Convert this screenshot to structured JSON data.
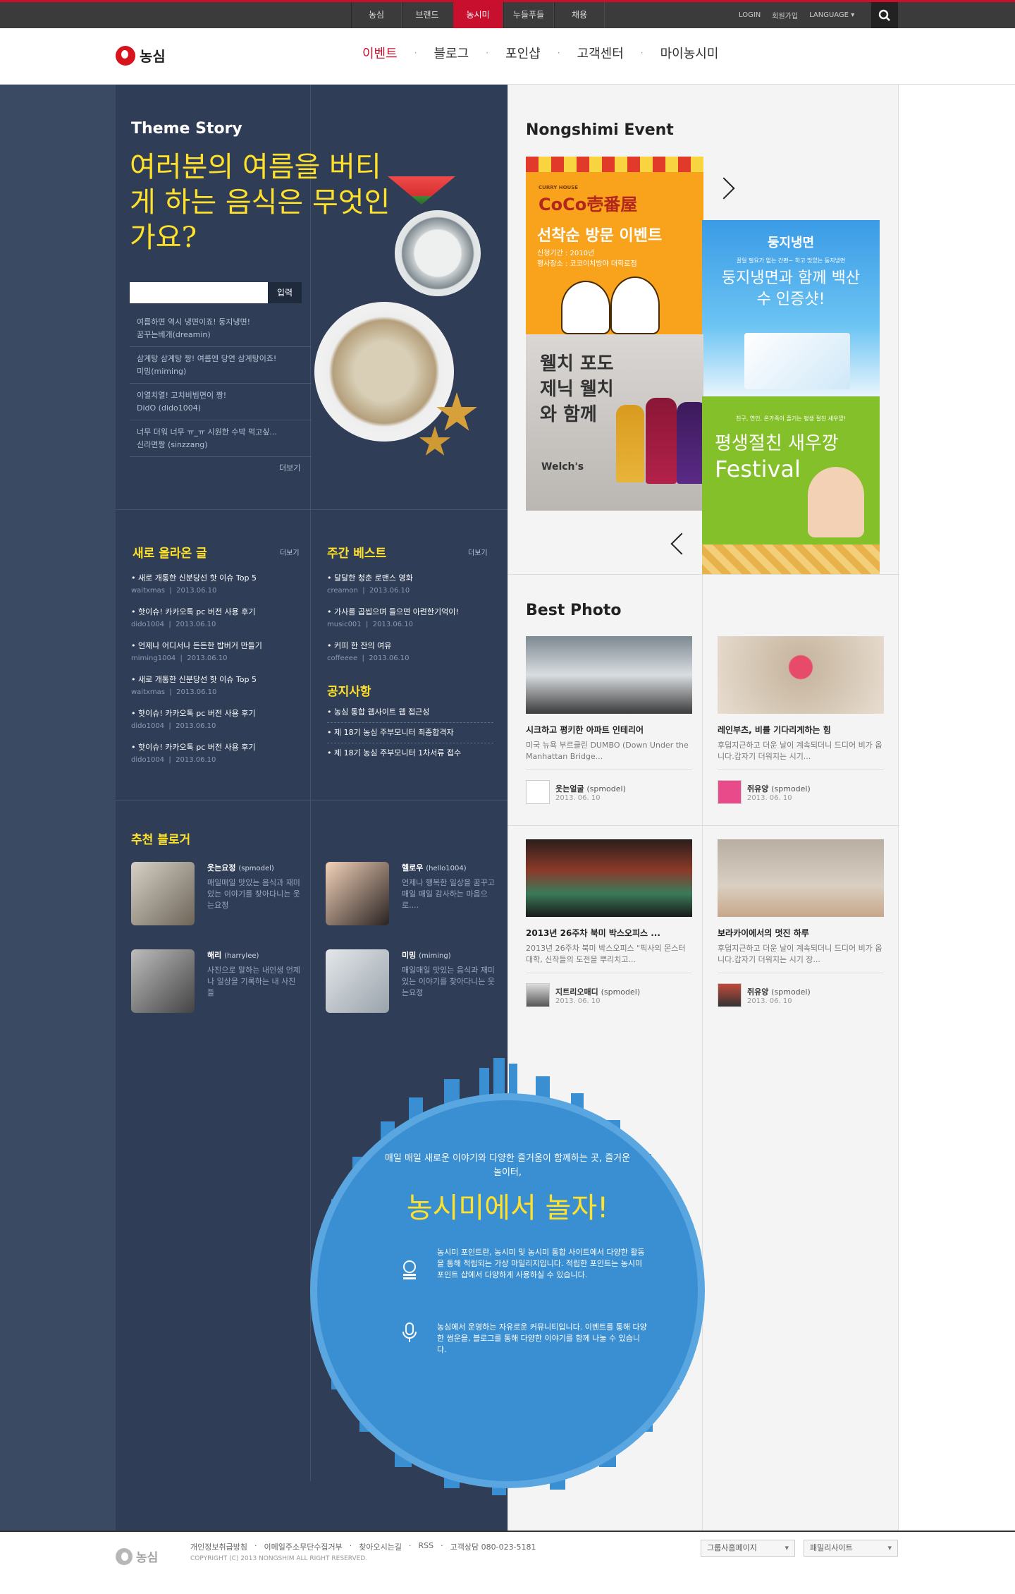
{
  "topnav": {
    "items": [
      "농심",
      "브랜드",
      "농시미",
      "누들푸들",
      "채용"
    ],
    "active_index": 2,
    "login": "LOGIN",
    "join": "회원가입",
    "language": "LANGUAGE"
  },
  "header": {
    "logo": "농심",
    "gnb": [
      "이벤트",
      "블로그",
      "포인샵",
      "고객센터",
      "마이농시미"
    ]
  },
  "theme": {
    "title": "Theme Story",
    "headline": "여러분의 여름을 버티게 하는 음식은 무엇인가요?",
    "input_placeholder": "",
    "submit_label": "입력",
    "comments": [
      {
        "text": "여름하면 역시 냉면이죠! 둥지냉면!",
        "author": "꿈꾸는베개(dreamin)"
      },
      {
        "text": "삼계탕 삼계탕 짱! 여름엔 당연 삼계탕이죠!",
        "author": "미밍(miming)"
      },
      {
        "text": "이열치열! 고치비빔면이 짱!",
        "author": "DidO (dido1004)"
      },
      {
        "text": "너무 더워 너무 ㅠ_ㅠ 시원한 수박 먹고싶...",
        "author": "신라면짱 (sinzzang)"
      }
    ],
    "more": "더보기"
  },
  "new_posts": {
    "title": "새로 올라온 글",
    "more": "더보기",
    "items": [
      {
        "title": "새로 개통한 신분당선 핫 이슈 Top 5",
        "author": "waitxmas",
        "date": "2013.06.10"
      },
      {
        "title": "핫이슈! 카카오톡 pc 버전 사용 후기",
        "author": "dido1004",
        "date": "2013.06.10"
      },
      {
        "title": "언제나 어디서나 든든한 밥버거 만들기",
        "author": "miming1004",
        "date": "2013.06.10"
      },
      {
        "title": "새로 개통한 신분당선 핫 이슈 Top 5",
        "author": "waitxmas",
        "date": "2013.06.10"
      },
      {
        "title": "핫이슈! 카카오톡 pc 버전 사용 후기",
        "author": "dido1004",
        "date": "2013.06.10"
      },
      {
        "title": "핫이슈! 카카오톡 pc 버전 사용 후기",
        "author": "dido1004",
        "date": "2013.06.10"
      }
    ]
  },
  "weekly_best": {
    "title": "주간 베스트",
    "more": "더보기",
    "items": [
      {
        "title": "달달한 청춘 로맨스 영화",
        "author": "creamon",
        "date": "2013.06.10"
      },
      {
        "title": "가사를 곱씹으며 들으면 아련한기억이!",
        "author": "music001",
        "date": "2013.06.10"
      },
      {
        "title": "커피 한 잔의 여유",
        "author": "coffeeee",
        "date": "2013.06.10"
      }
    ]
  },
  "notice": {
    "title": "공지사항",
    "items": [
      "농심 통합 웹사이트 웹 접근성",
      "제 18기 농심 주부모니터 최종합격자",
      "제 18기 농심 주부모니터 1차서류 접수"
    ]
  },
  "bloggers": {
    "title": "추천 블로거",
    "items": [
      {
        "name": "웃는요정",
        "id": "(spmodel)",
        "desc": "매일매일 맛있는 음식과 재미있는 이야기를 찾아다니는 웃는요정"
      },
      {
        "name": "헬로우",
        "id": "(hello1004)",
        "desc": "언제나 행복한 일상을 꿈꾸고 매일 매일 감사하는 마음으로...."
      },
      {
        "name": "해리",
        "id": "(harrylee)",
        "desc": "사진으로 말하는 내인생 언제나 일상을 기록하는 내 사진들"
      },
      {
        "name": "미밍",
        "id": "(miming)",
        "desc": "매일매일 맛있는 음식과 재미있는 이야기를 찾아다니는 웃는요정"
      }
    ]
  },
  "promo": {
    "intro": "매일 매일 새로운 이야기와 다양한 즐거움이 함께하는 곳, 즐거운 놀이터,",
    "headline": "농시미에서 놀자!",
    "point": "농시미 포인트란, 농시미 및 농시미 통합 사이트에서 다양한 활동을 통해 적립되는 가상 마일리지입니다. 적립한 포인트는 농시미포인트 샵에서 다양하게 사용하실 수 있습니다.",
    "community": "농심에서 운영하는 자유로운 커뮤니티입니다. 이벤트를 통해 다양한 썸운을, 블로그를 통해 다양한 이야기를 함께 나눌 수 있습니다.",
    "icon1": "rss-icon",
    "icon2": "microphone-icon"
  },
  "events": {
    "title": "Nongshimi Event",
    "coco": {
      "brand_small": "CURRY HOUSE",
      "brand": "CoCo壱番屋",
      "headline": "선착순 방문 이벤트",
      "period": "신청기간 : 2010년",
      "place": "행사장소 : 코코이치방야 대학로점"
    },
    "dungji": {
      "brand": "둥지냉면",
      "sub": "꼴일 필요가 없는 간편~ 하고 맛있는 둥지냉면",
      "headline": "둥지냉면과 함께 백산수 인증샷!"
    },
    "welchs": {
      "headline": "웰치 포도제닉 웰치와 함께",
      "brand": "Welch's"
    },
    "saewoo": {
      "sub": "친구, 연인, 온가족이 즐기는 평생 절친 새우깡!",
      "headline1": "평생절친 새우깡",
      "headline2": "Festival"
    }
  },
  "best_photo": {
    "title": "Best Photo",
    "items": [
      {
        "title": "시크하고 평키한 아파트 인테리어",
        "desc": "미국 뉴욕 부르클린 DUMBO (Down Under the Manhattan Bridge...",
        "author": "웃는얼굴",
        "id": "(spmodel)",
        "date": "2013. 06. 10"
      },
      {
        "title": "레인부츠, 비를 기다리게하는 힘",
        "desc": "후덥지근하고 더운 날이 계속되더니 드디어 비가 옵니다.갑자기 더워지는 시기...",
        "author": "쥐유앙",
        "id": "(spmodel)",
        "date": "2013. 06. 10"
      },
      {
        "title": "2013년 26주차 북미 박스오피스 ...",
        "desc": "2013년 26주차 북미 박스오피스 \"픽사의 몬스터대학, 신작들의 도전을 뿌리치고...",
        "author": "지트리오매디",
        "id": "(spmodel)",
        "date": "2013. 06. 10"
      },
      {
        "title": "보라카이에서의 멋진 하루",
        "desc": "후덥지근하고 더운 날이 계속되더니 드디어 비가 옵니다.갑자기 더워지는 시기 장...",
        "author": "쥐유앙",
        "id": "(spmodel)",
        "date": "2013. 06. 10"
      }
    ]
  },
  "footer": {
    "logo": "농심",
    "links": [
      "개인정보취급방침",
      "이메일주소무단수집거부",
      "찾아오시는길",
      "RSS",
      "고객상담 080-023-5181"
    ],
    "copyright": "COPYRIGHT (C) 2013 NONGSHIM ALL RIGHT RESERVED.",
    "select1": "그룹사홈페이지",
    "select2": "패밀리사이트"
  }
}
